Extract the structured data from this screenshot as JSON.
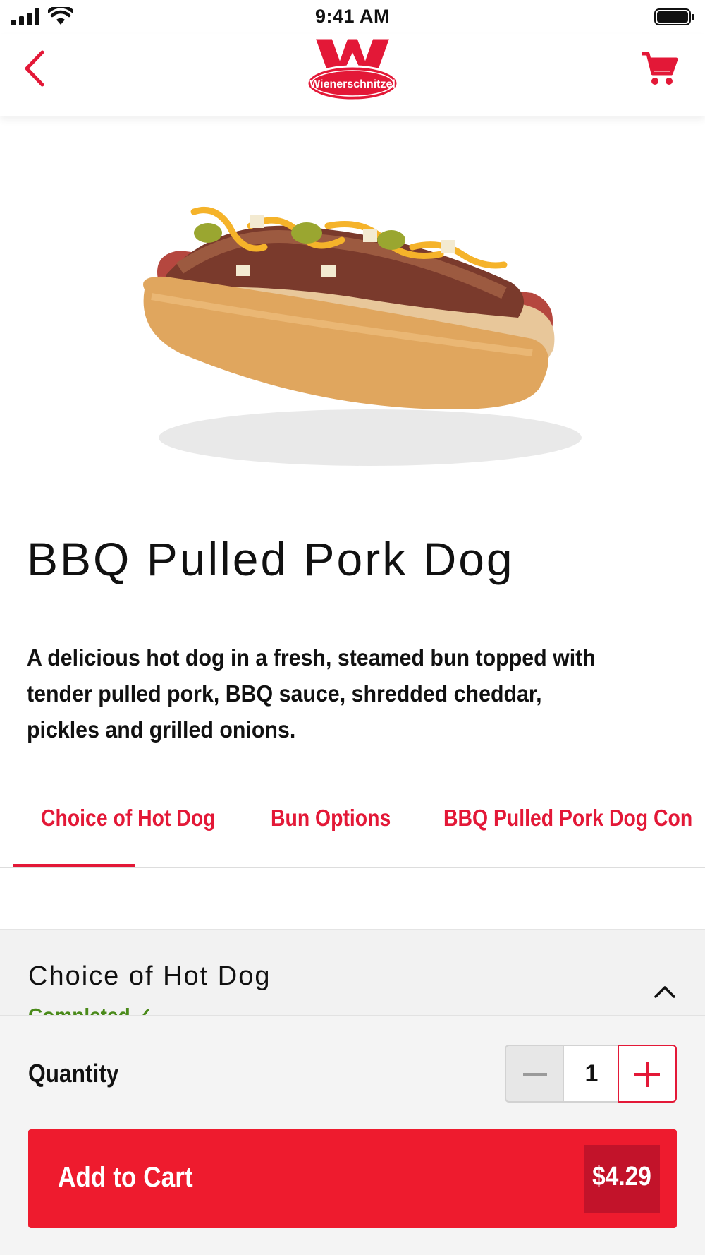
{
  "status_bar": {
    "time": "9:41 AM"
  },
  "header": {
    "brand": "Wienerschnitzel"
  },
  "product": {
    "name": "BBQ Pulled Pork Dog",
    "description": "A delicious hot dog in a fresh, steamed bun topped with tender pulled pork, BBQ sauce, shredded cheddar, pickles and grilled onions."
  },
  "tabs": [
    {
      "label": "Choice of Hot Dog"
    },
    {
      "label": "Bun Options"
    },
    {
      "label": "BBQ Pulled Pork Dog Con"
    }
  ],
  "section": {
    "title": "Choice of Hot Dog",
    "status": "Completed ✓"
  },
  "quantity": {
    "label": "Quantity",
    "value": "1"
  },
  "cart_button": {
    "label": "Add to Cart",
    "price": "$4.29"
  },
  "colors": {
    "brand_red": "#ee1b2e",
    "price_badge": "#c2132a",
    "completed_green": "#4a8a1a"
  }
}
